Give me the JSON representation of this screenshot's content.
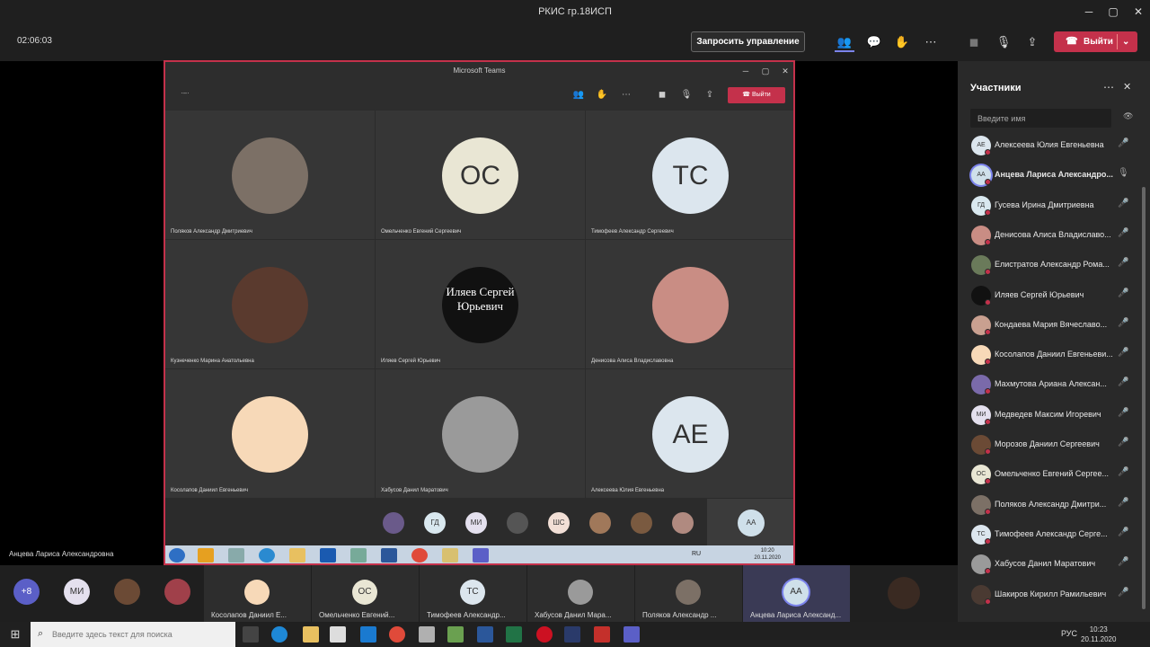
{
  "window": {
    "title": "РКИС гр.18ИСП"
  },
  "toolbar": {
    "timer": "02:06:03",
    "request_control": "Запросить управление",
    "leave": "Выйти"
  },
  "shared_window": {
    "title": "Microsoft Teams",
    "leave": "Выйти",
    "tiles": [
      {
        "name": "Поляков Александр Дмитриевич",
        "initials": "",
        "avatar_color": "#7c7066"
      },
      {
        "name": "Омельченко Евгений Сергеевич",
        "initials": "ОС",
        "avatar_color": "#e9e6d4"
      },
      {
        "name": "Тимофеев Александр Сергеевич",
        "initials": "ТС",
        "avatar_color": "#dce6ee"
      },
      {
        "name": "Кузнеченко Марина Анатольевна",
        "initials": "",
        "avatar_color": "#5a3a2e"
      },
      {
        "name": "Иляев Сергей Юрьевич",
        "initials": "Иляев Сергей Юрьевич",
        "avatar_color": "#111111"
      },
      {
        "name": "Денисова Алиса Владиславовна",
        "initials": "",
        "avatar_color": "#c98d84"
      },
      {
        "name": "Косолапов Даниил Евгеньевич",
        "initials": "",
        "avatar_color": "#f7d9b8"
      },
      {
        "name": "Хабусов Данил Маратович",
        "initials": "",
        "avatar_color": "#9a9a9a"
      },
      {
        "name": "Алексеева Юлия Евгеньевна",
        "initials": "АЕ",
        "avatar_color": "#dce6ee"
      }
    ],
    "strip": [
      {
        "initials": "",
        "color": "#6a5a8a"
      },
      {
        "initials": "ГД",
        "color": "#d9e8ef"
      },
      {
        "initials": "МИ",
        "color": "#e4e0ee"
      },
      {
        "initials": "",
        "color": "#555555"
      },
      {
        "initials": "ШС",
        "color": "#f2dfd6"
      },
      {
        "initials": "",
        "color": "#a0785a"
      },
      {
        "initials": "",
        "color": "#7a5a40"
      },
      {
        "initials": "",
        "color": "#b08a80"
      }
    ],
    "self_initials": "АА",
    "taskbar_lang": "RU",
    "taskbar_time": "10:20",
    "taskbar_date": "20.11.2020"
  },
  "presenter_name": "Анцева Лариса Александровна",
  "bottom_strip": {
    "overflow": "+8",
    "small": [
      {
        "initials": "МИ",
        "color": "#e4e0ee"
      },
      {
        "initials": "",
        "color": "#6b4a35"
      },
      {
        "initials": "",
        "color": "#a0404a"
      }
    ],
    "tiles": [
      {
        "name": "Косолапов Даниил Е...",
        "initials": "",
        "color": "#f7d9b8"
      },
      {
        "name": "Омельченко Евгений...",
        "initials": "ОС",
        "color": "#e9e6d4"
      },
      {
        "name": "Тимофеев Александр...",
        "initials": "ТС",
        "color": "#dce6ee"
      },
      {
        "name": "Хабусов Данил Мара...",
        "initials": "",
        "color": "#9a9a9a"
      },
      {
        "name": "Поляков Александр ...",
        "initials": "",
        "color": "#7c7066"
      },
      {
        "name": "Анцева Лариса Александ...",
        "initials": "АА",
        "color": "#cfe0ea"
      }
    ],
    "last_avatar_color": "#3a2a22"
  },
  "participants_panel": {
    "title": "Участники",
    "search_placeholder": "Введите имя",
    "items": [
      {
        "name": "Алексеева Юлия Евгеньевна",
        "initials": "АЕ",
        "color": "#dce6ee"
      },
      {
        "name": "Анцева Лариса Александро...",
        "initials": "АА",
        "color": "#cfe0ea"
      },
      {
        "name": "Гусева Ирина Дмитриевна",
        "initials": "ГД",
        "color": "#d9e8ef"
      },
      {
        "name": "Денисова Алиса Владиславо...",
        "initials": "",
        "color": "#c98d84"
      },
      {
        "name": "Елистратов Александр Рома...",
        "initials": "",
        "color": "#6a7a5a"
      },
      {
        "name": "Иляев Сергей Юрьевич",
        "initials": "",
        "color": "#111111"
      },
      {
        "name": "Кондаева Мария Вячеславо...",
        "initials": "",
        "color": "#c9a090"
      },
      {
        "name": "Косолапов Даниил Евгеньеви...",
        "initials": "",
        "color": "#f7d9b8"
      },
      {
        "name": "Махмутова Ариана Алексан...",
        "initials": "",
        "color": "#7a6aaa"
      },
      {
        "name": "Медведев Максим Игоревич",
        "initials": "МИ",
        "color": "#e4e0ee"
      },
      {
        "name": "Морозов Даниил Сергеевич",
        "initials": "",
        "color": "#6b4a35"
      },
      {
        "name": "Омельченко Евгений Сергее...",
        "initials": "ОС",
        "color": "#e9e6d4"
      },
      {
        "name": "Поляков Александр Дмитри...",
        "initials": "",
        "color": "#7c7066"
      },
      {
        "name": "Тимофеев Александр Серге...",
        "initials": "ТС",
        "color": "#dce6ee"
      },
      {
        "name": "Хабусов Данил Маратович",
        "initials": "",
        "color": "#9a9a9a"
      },
      {
        "name": "Шакиров Кирилл Рамильевич",
        "initials": "",
        "color": "#4a3a32"
      }
    ]
  },
  "taskbar": {
    "search_placeholder": "Введите здесь текст для поиска",
    "lang": "РУС",
    "time": "10:23",
    "date": "20.11.2020"
  }
}
